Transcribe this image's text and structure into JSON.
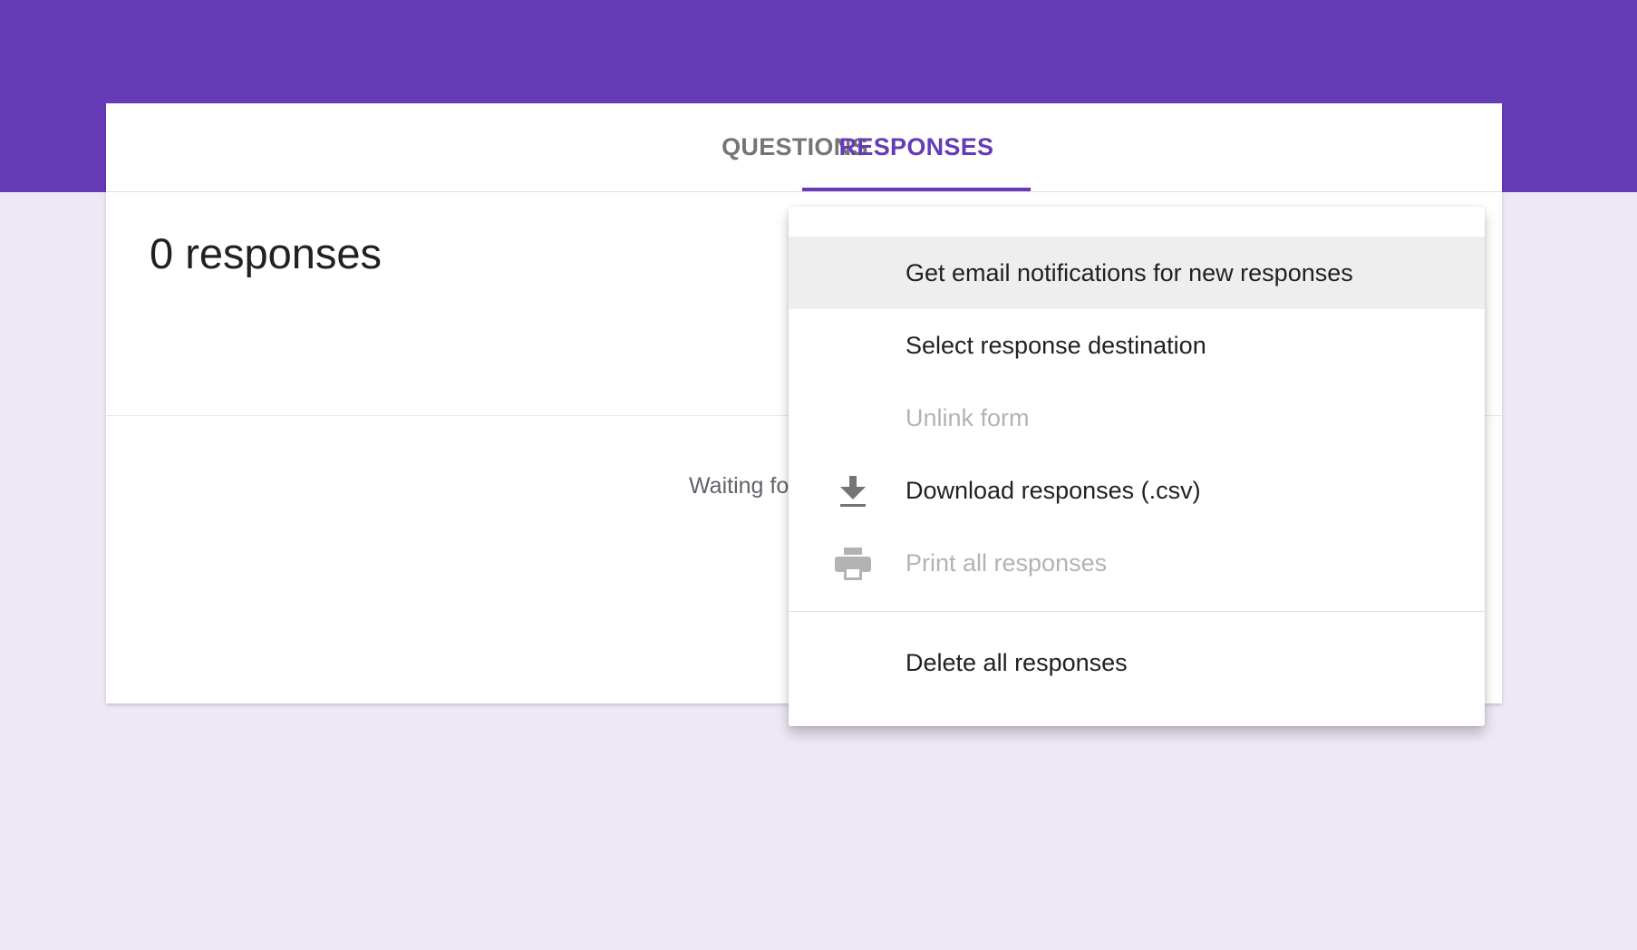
{
  "tabs": {
    "questions": "QUESTIONS",
    "responses": "RESPONSES"
  },
  "responses": {
    "count_label": "0 responses",
    "waiting_text": "Waiting fo"
  },
  "menu": {
    "items": [
      {
        "label": "Get email notifications for new responses",
        "icon": "",
        "enabled": true
      },
      {
        "label": "Select response destination",
        "icon": "",
        "enabled": true
      },
      {
        "label": "Unlink form",
        "icon": "",
        "enabled": false
      },
      {
        "label": "Download responses (.csv)",
        "icon": "download-icon",
        "enabled": true
      },
      {
        "label": "Print all responses",
        "icon": "print-icon",
        "enabled": false
      },
      {
        "label": "Delete all responses",
        "icon": "",
        "enabled": true
      }
    ]
  },
  "colors": {
    "brand": "#673ab7",
    "background": "#ede7f6",
    "disabled_text": "#b3b3b3"
  }
}
